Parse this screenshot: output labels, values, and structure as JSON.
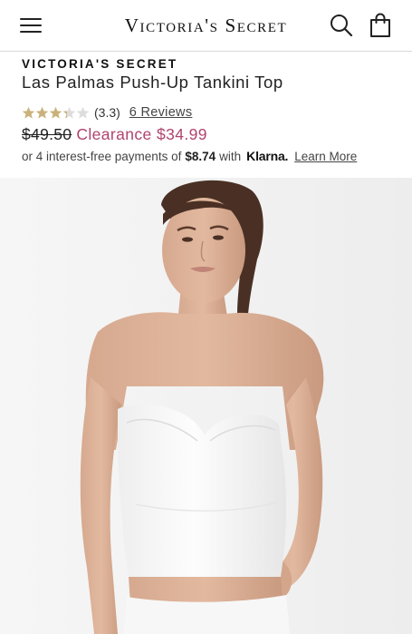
{
  "header": {
    "brand_logo": "Victoria's Secret",
    "menu_icon": "hamburger-menu-icon",
    "search_icon": "search-icon",
    "bag_icon": "shopping-bag-icon"
  },
  "product": {
    "brand": "VICTORIA'S SECRET",
    "title": "Las Palmas Push-Up Tankini Top",
    "rating": 3.3,
    "rating_max": 5,
    "rating_text": "(3.3)",
    "reviews_text": "6 Reviews",
    "original_price": "$49.50",
    "sale_price": "Clearance $34.99",
    "payments": {
      "prefix": "or 4 interest-free payments of",
      "amount": "$8.74",
      "with_text": "with",
      "provider": "Klarna.",
      "learn_more": "Learn More"
    },
    "image_icon": "model-photo"
  },
  "colors": {
    "star_filled": "#c9b17a",
    "star_empty": "#dddddd",
    "sale_price": "#b0436d",
    "text": "#222222",
    "divider": "#d9d9d9"
  }
}
